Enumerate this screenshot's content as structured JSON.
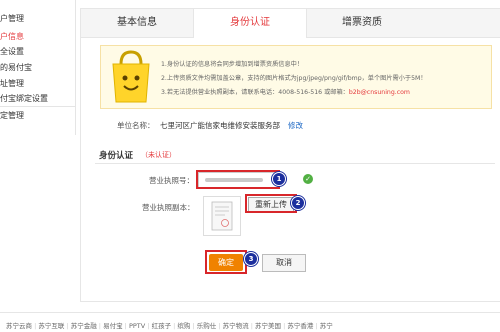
{
  "sidebar": {
    "items": [
      {
        "label": "户管理"
      },
      {
        "label": "户信息"
      },
      {
        "label": "全设置"
      },
      {
        "label": "的易付宝"
      },
      {
        "label": "址管理"
      },
      {
        "label": "付宝绑定设置"
      },
      {
        "label": "定管理"
      }
    ]
  },
  "tabs": [
    {
      "label": "基本信息"
    },
    {
      "label": "身份认证"
    },
    {
      "label": "增票资质"
    }
  ],
  "notice": {
    "line1": "1.身份认证的信息将会同步增加到增票资质信息中！",
    "line2": "2.上传资质文件均需加盖公章，支持的图片格式为jpg/jpeg/png/gif/bmp，单个图片需小于5M！",
    "line3_prefix": "3.若无法提供营业执照副本，请联系电话：4008-516-516 或邮箱：",
    "line3_email": "b2b@cnsuning.com"
  },
  "unit": {
    "label": "单位名称：",
    "value": "七里河区广能信家电维修安装服务部",
    "modify": "修改"
  },
  "section": {
    "title": "身份认证",
    "status": "（未认证）"
  },
  "form": {
    "license_no_label": "营业执照号：",
    "license_copy_label": "营业执照副本：",
    "reupload": "重新上传",
    "confirm": "确定",
    "cancel": "取消"
  },
  "markers": [
    "1",
    "2",
    "3"
  ],
  "footer": [
    "苏宁云商",
    "苏宁互联",
    "苏宁金融",
    "易付宝",
    "PPTV",
    "红孩子",
    "缤购",
    "乐购仕",
    "苏宁物流",
    "苏宁美国",
    "苏宁香港",
    "苏宁"
  ],
  "colors": {
    "accent": "#e4393c",
    "confirm_button": "#f08200",
    "marker": "#1c2f9e",
    "highlight_box": "#d8262a",
    "success": "#52b043"
  }
}
